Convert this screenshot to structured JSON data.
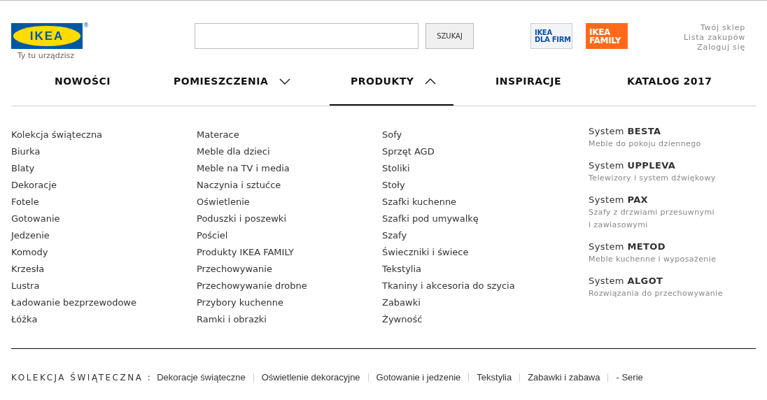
{
  "header": {
    "logo": {
      "text": "IKEA",
      "trademark": "®"
    },
    "tagline": "Ty tu urządzisz",
    "search": {
      "button": "SZUKAJ"
    },
    "partner_logos": [
      {
        "kind": "business",
        "lines": [
          "IKEA",
          "DLA FIRM"
        ]
      },
      {
        "kind": "family",
        "lines": [
          "IKEA",
          "FAMILY"
        ]
      }
    ],
    "account_links": [
      "Twój sklep",
      "Lista zakupów",
      "Zaloguj się"
    ]
  },
  "nav": [
    {
      "label": "NOWOŚCI",
      "kind": "link",
      "selected": false
    },
    {
      "label": "POMIESZCZENIA",
      "kind": "menu",
      "expanded": false,
      "selected": false
    },
    {
      "label": "PRODUKTY",
      "kind": "menu",
      "expanded": true,
      "selected": true
    },
    {
      "label": "INSPIRACJE",
      "kind": "link",
      "selected": false
    },
    {
      "label": "KATALOG 2017",
      "kind": "link",
      "selected": false
    }
  ],
  "product_columns": [
    [
      "Kolekcja świąteczna",
      "Biurka",
      "Blaty",
      "Dekoracje",
      "Fotele",
      "Gotowanie",
      "Jedzenie",
      "Komody",
      "Krzesła",
      "Lustra",
      "Ładowanie bezprzewodowe",
      "Łóżka"
    ],
    [
      "Materace",
      "Meble dla dzieci",
      "Meble na TV i media",
      "Naczynia i sztućce",
      "Oświetlenie",
      "Poduszki i poszewki",
      "Pościel",
      "Produkty IKEA FAMILY",
      "Przechowywanie",
      "Przechowywanie drobne",
      "Przybory kuchenne",
      "Ramki i obrazki"
    ],
    [
      "Sofy",
      "Sprzęt AGD",
      "Stoliki",
      "Stoły",
      "Szafki kuchenne",
      "Szafki pod umywalkę",
      "Szafy",
      "Świeczniki i świece",
      "Tekstylia",
      "Tkaniny i akcesoria do szycia",
      "Zabawki",
      "Żywność"
    ]
  ],
  "systems": [
    {
      "title": "System **BESTA**",
      "description": [
        "Meble do pokoju dziennego"
      ]
    },
    {
      "title": "System **UPPLEVA**",
      "description": [
        "Telewizory i system dźwiękowy"
      ]
    },
    {
      "title": "System **PAX**",
      "description": [
        "Szafy z drzwiami przesuwnymi",
        "i zawiasowymi"
      ]
    },
    {
      "title": "System **METOD**",
      "description": [
        "Meble kuchenne i wyposażenie"
      ]
    },
    {
      "title": "System **ALGOT**",
      "description": [
        "Rozwiązania do przechowywanie"
      ]
    }
  ],
  "footer": {
    "label": "KOLEKCJA ŚWIĄTECZNA :",
    "links": [
      "Dekoracje świąteczne",
      "Oświetlenie dekoracyjne",
      "Gotowanie i jedzenie",
      "Tekstylia",
      "Zabawki i zabawa",
      "- Serie"
    ]
  }
}
